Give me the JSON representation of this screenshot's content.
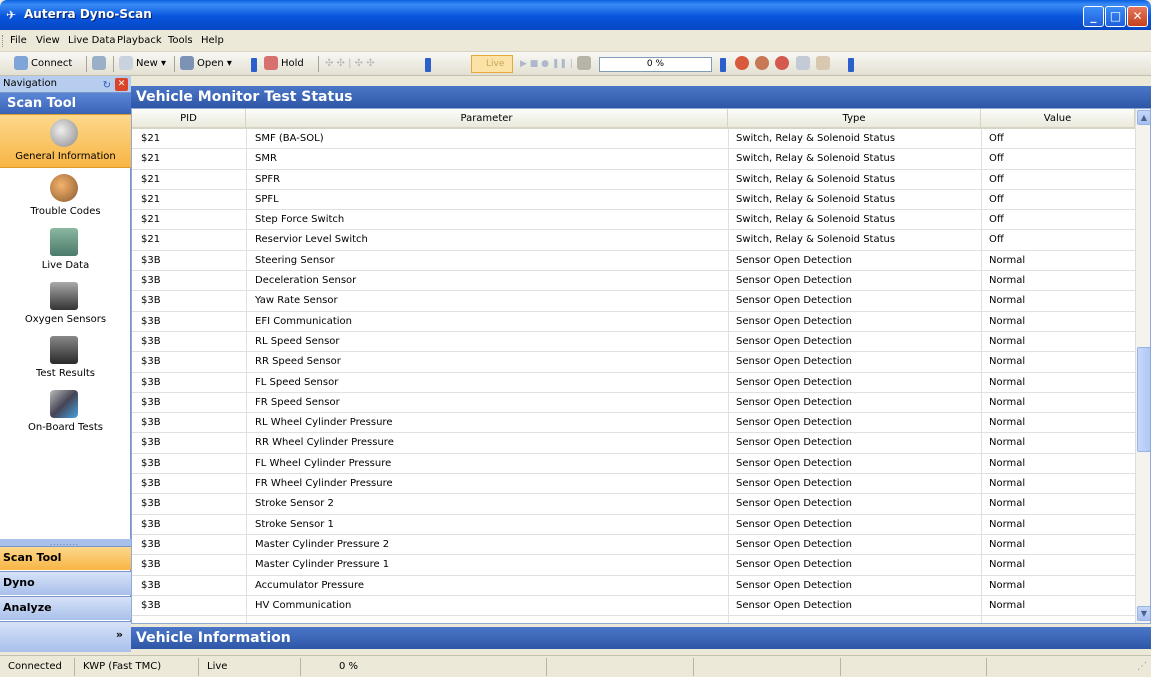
{
  "window": {
    "title": "Auterra Dyno-Scan"
  },
  "menu": [
    "File",
    "View",
    "Live Data",
    "Playback",
    "Tools",
    "Help"
  ],
  "toolbar": {
    "connect": "Connect",
    "new": "New ▾",
    "open": "Open ▾",
    "hold": "Hold",
    "live": "Live",
    "progress": "0 %"
  },
  "navigation": {
    "header": "Navigation",
    "title": "Scan Tool",
    "items": [
      {
        "label": "General Information",
        "icon": "magnifier-icon",
        "active": true
      },
      {
        "label": "Trouble Codes",
        "icon": "wrench-icon"
      },
      {
        "label": "Live Data",
        "icon": "monitor-icon"
      },
      {
        "label": "Oxygen Sensors",
        "icon": "sensor-icon"
      },
      {
        "label": "Test Results",
        "icon": "meter-icon"
      },
      {
        "label": "On-Board Tests",
        "icon": "engine-icon"
      }
    ],
    "bottom": [
      "Scan Tool",
      "Dyno",
      "Analyze"
    ]
  },
  "monitor": {
    "title": "Vehicle Monitor Test Status",
    "columns": [
      "PID",
      "Parameter",
      "Type",
      "Value"
    ],
    "rows": [
      [
        "$21",
        "SMF (BA-SOL)",
        "Switch, Relay & Solenoid Status",
        "Off"
      ],
      [
        "$21",
        "SMR",
        "Switch, Relay & Solenoid Status",
        "Off"
      ],
      [
        "$21",
        "SPFR",
        "Switch, Relay & Solenoid Status",
        "Off"
      ],
      [
        "$21",
        "SPFL",
        "Switch, Relay & Solenoid Status",
        "Off"
      ],
      [
        "$21",
        "Step Force Switch",
        "Switch, Relay & Solenoid Status",
        "Off"
      ],
      [
        "$21",
        "Reservior Level Switch",
        "Switch, Relay & Solenoid Status",
        "Off"
      ],
      [
        "$3B",
        "Steering Sensor",
        "Sensor Open Detection",
        "Normal"
      ],
      [
        "$3B",
        "Deceleration Sensor",
        "Sensor Open Detection",
        "Normal"
      ],
      [
        "$3B",
        "Yaw Rate Sensor",
        "Sensor Open Detection",
        "Normal"
      ],
      [
        "$3B",
        "EFI Communication",
        "Sensor Open Detection",
        "Normal"
      ],
      [
        "$3B",
        "RL Speed Sensor",
        "Sensor Open Detection",
        "Normal"
      ],
      [
        "$3B",
        "RR Speed Sensor",
        "Sensor Open Detection",
        "Normal"
      ],
      [
        "$3B",
        "FL Speed Sensor",
        "Sensor Open Detection",
        "Normal"
      ],
      [
        "$3B",
        "FR Speed Sensor",
        "Sensor Open Detection",
        "Normal"
      ],
      [
        "$3B",
        "RL Wheel Cylinder Pressure",
        "Sensor Open Detection",
        "Normal"
      ],
      [
        "$3B",
        "RR Wheel Cylinder Pressure",
        "Sensor Open Detection",
        "Normal"
      ],
      [
        "$3B",
        "FL Wheel Cylinder Pressure",
        "Sensor Open Detection",
        "Normal"
      ],
      [
        "$3B",
        "FR Wheel Cylinder Pressure",
        "Sensor Open Detection",
        "Normal"
      ],
      [
        "$3B",
        "Stroke Sensor 2",
        "Sensor Open Detection",
        "Normal"
      ],
      [
        "$3B",
        "Stroke Sensor 1",
        "Sensor Open Detection",
        "Normal"
      ],
      [
        "$3B",
        "Master Cylinder Pressure 2",
        "Sensor Open Detection",
        "Normal"
      ],
      [
        "$3B",
        "Master Cylinder Pressure 1",
        "Sensor Open Detection",
        "Normal"
      ],
      [
        "$3B",
        "Accumulator Pressure",
        "Sensor Open Detection",
        "Normal"
      ],
      [
        "$3B",
        "HV Communication",
        "Sensor Open Detection",
        "Normal"
      ]
    ]
  },
  "vehicle_info": {
    "title": "Vehicle Information"
  },
  "status": {
    "connection": "Connected",
    "protocol": "KWP (Fast TMC)",
    "mode": "Live",
    "progress": "0 %"
  }
}
